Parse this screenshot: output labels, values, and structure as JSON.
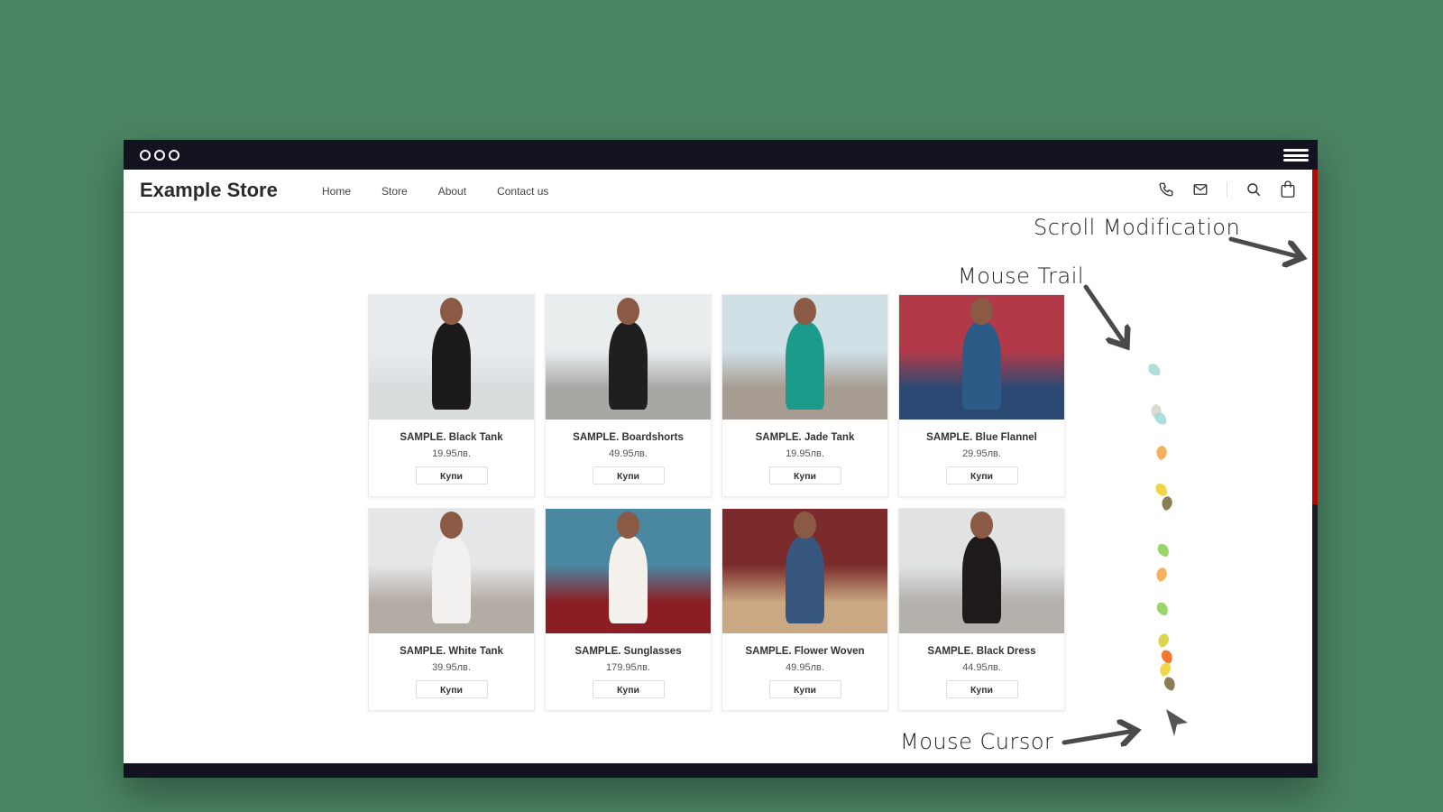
{
  "window": {
    "titlebar_icon": "traffic-dots-icon",
    "menu_icon": "hamburger-icon",
    "scroll_position_fraction": 0.0,
    "scroll_thumb_fraction": 0.55
  },
  "nav": {
    "brand": "Example Store",
    "links": [
      "Home",
      "Store",
      "About",
      "Contact us"
    ],
    "icons": [
      "phone-icon",
      "mail-icon",
      "search-icon",
      "shopping-bag-icon"
    ]
  },
  "products": [
    {
      "name": "SAMPLE. Black Tank",
      "price": "19.95лв.",
      "button": "Купи",
      "colors": [
        "#e8ecef",
        "#d9dcdd",
        "#1c1a1a"
      ]
    },
    {
      "name": "SAMPLE. Boardshorts",
      "price": "49.95лв.",
      "button": "Купи",
      "colors": [
        "#e9edee",
        "#a9a7a4",
        "#1f1f21"
      ]
    },
    {
      "name": "SAMPLE. Jade Tank",
      "price": "19.95лв.",
      "button": "Купи",
      "colors": [
        "#cfe0e6",
        "#a79c92",
        "#1c9a8a"
      ]
    },
    {
      "name": "SAMPLE. Blue Flannel",
      "price": "29.95лв.",
      "button": "Купи",
      "colors": [
        "#b23a48",
        "#2b4a73",
        "#2d5b87"
      ]
    },
    {
      "name": "SAMPLE. White Tank",
      "price": "39.95лв.",
      "button": "Купи",
      "colors": [
        "#e4e6e7",
        "#b3aca4",
        "#f3f1ef"
      ]
    },
    {
      "name": "SAMPLE. Sunglasses",
      "price": "179.95лв.",
      "button": "Купи",
      "colors": [
        "#4a88a2",
        "#8b1e24",
        "#f4f1ec"
      ]
    },
    {
      "name": "SAMPLE. Flower Woven",
      "price": "49.95лв.",
      "button": "Купи",
      "colors": [
        "#7b2b2b",
        "#c9a883",
        "#37577e"
      ]
    },
    {
      "name": "SAMPLE. Black Dress",
      "price": "44.95лв.",
      "button": "Купи",
      "colors": [
        "#e1e3e3",
        "#b4b1ad",
        "#1f1b1b"
      ]
    }
  ],
  "annotations": {
    "scroll": "Scroll Modification",
    "trail": "Mouse Trail",
    "cursor": "Mouse Cursor"
  },
  "trail": [
    {
      "color": "#a6dcd8"
    },
    {
      "color": "#d8d5cb"
    },
    {
      "color": "#a6dcd8"
    },
    {
      "color": "#f6a84a"
    },
    {
      "color": "#f1d234"
    },
    {
      "color": "#7c7041"
    },
    {
      "color": "#8ed25a"
    },
    {
      "color": "#f6a84a"
    },
    {
      "color": "#8ed25a"
    },
    {
      "color": "#d6d23a"
    },
    {
      "color": "#f06a18"
    },
    {
      "color": "#f1d234"
    },
    {
      "color": "#7c7041"
    }
  ],
  "colors": {
    "background": "#4b8463",
    "titlebar": "#13121f",
    "scroll_thumb": "#b00c0c",
    "scroll_track": "#1c1c25",
    "arrow": "#4a4a4a"
  }
}
